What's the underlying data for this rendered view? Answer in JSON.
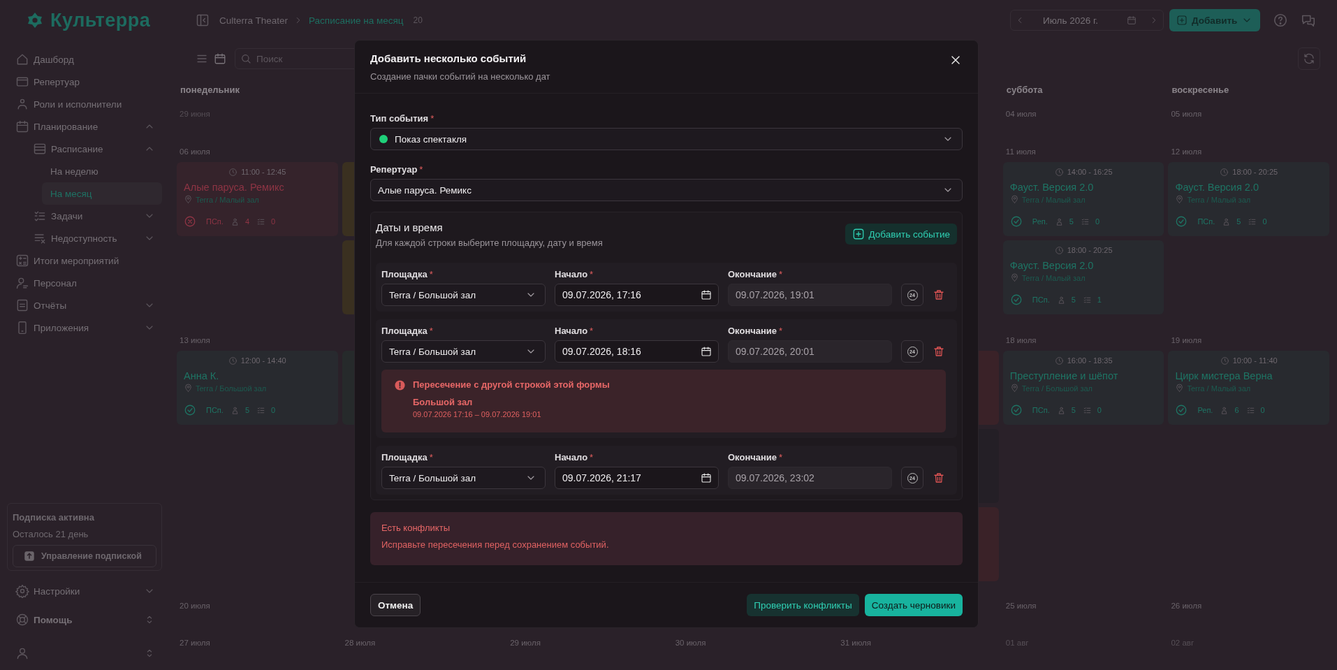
{
  "sidebar": {
    "logo": "Культерра",
    "items": [
      {
        "label": "Дашборд",
        "kind": "link",
        "selected": false
      },
      {
        "label": "Репертуар",
        "kind": "link",
        "selected": false
      },
      {
        "label": "Роли и исполнители",
        "kind": "link",
        "selected": false
      },
      {
        "label": "Планирование",
        "kind": "group",
        "expanded": true,
        "selected": false,
        "children": [
          {
            "label": "Расписание",
            "kind": "group",
            "expanded": true,
            "selected": false,
            "children": [
              {
                "label": "На неделю",
                "kind": "link",
                "selected": false
              },
              {
                "label": "На месяц",
                "kind": "link",
                "selected": true
              }
            ]
          },
          {
            "label": "Задачи",
            "kind": "group",
            "expanded": false,
            "selected": false
          },
          {
            "label": "Недоступность",
            "kind": "group",
            "expanded": false,
            "selected": false
          }
        ]
      },
      {
        "label": "Итоги мероприятий",
        "kind": "link",
        "selected": false
      },
      {
        "label": "Персонал",
        "kind": "link",
        "selected": false
      },
      {
        "label": "Отчёты",
        "kind": "group",
        "expanded": false,
        "selected": false
      },
      {
        "label": "Приложения",
        "kind": "group",
        "expanded": false,
        "selected": false
      }
    ],
    "subscription": {
      "title": "Подписка активна",
      "remaining": "Осталось 21 день",
      "button": "Управление подпиской"
    },
    "footer_items": [
      {
        "label": "Настройки",
        "kind": "group",
        "expanded": false
      },
      {
        "label": "Помощь",
        "kind": "switcher"
      },
      {
        "kind": "user"
      }
    ]
  },
  "topbar": {
    "breadcrumbs": [
      {
        "label": "Culterra Theater",
        "selected": false
      },
      {
        "label": "Расписание на месяц",
        "selected": true
      }
    ],
    "count": "20",
    "month": "Июль 2026 г.",
    "add_button": "Добавить"
  },
  "toolbar": {
    "views": [
      {
        "kind": "list",
        "selected": false
      },
      {
        "kind": "calendar",
        "selected": true
      }
    ],
    "search": {
      "placeholder": "Поиск"
    }
  },
  "calendar": {
    "weekdays": {
      "start": [
        {
          "label": "понедельник"
        }
      ],
      "end": [
        {
          "label": "суббота"
        },
        {
          "label": "воскресенье"
        }
      ]
    },
    "weeks": [
      {
        "start_days": [
          {
            "kind": "day",
            "date": "29 июня",
            "outside": true
          }
        ],
        "end_days": [
          {
            "kind": "day",
            "date": "04 июля",
            "outside": false
          },
          {
            "kind": "day",
            "date": "05 июля",
            "outside": false
          }
        ]
      },
      {
        "start_days": [
          {
            "kind": "day",
            "date": "06 июля",
            "outside": false,
            "events": [
              {
                "time": "11:00 - 12:45",
                "title": "Алые паруса. Ремикс",
                "venue": "Terra / Малый зал",
                "confirmed": false,
                "type": "ПСп.",
                "people": "4",
                "tasks": "0",
                "color": "#8e3444"
              }
            ]
          },
          {
            "kind": "covered",
            "events": [
              {
                "color": "#3a3020"
              },
              {
                "color": "#3a3020"
              }
            ]
          }
        ],
        "end_days": [
          {
            "kind": "day",
            "date": "11 июля",
            "outside": false,
            "events": [
              {
                "time": "14:00 - 16:25",
                "title": "Фауст. Версия 2.0",
                "venue": "Terra / Малый зал",
                "confirmed": true,
                "type": "Реп.",
                "people": "5",
                "tasks": "0",
                "color": "#1e7464"
              },
              {
                "time": "18:00 - 20:25",
                "title": "Фауст. Версия 2.0",
                "venue": "Terra / Малый зал",
                "confirmed": true,
                "type": "ПСп.",
                "people": "5",
                "tasks": "1",
                "color": "#1e7464"
              }
            ]
          },
          {
            "kind": "day",
            "date": "12 июля",
            "outside": false,
            "events": [
              {
                "time": "18:00 - 20:25",
                "title": "Фауст. Версия 2.0",
                "venue": "Terra / Малый зал",
                "confirmed": true,
                "type": "ПСп.",
                "people": "5",
                "tasks": "0",
                "color": "#1e7464"
              }
            ]
          }
        ]
      },
      {
        "start_days": [
          {
            "kind": "day",
            "date": "13 июля",
            "outside": false,
            "events": [
              {
                "time": "12:00 - 14:40",
                "title": "Анна К.",
                "venue": "Terra / Большой зал",
                "confirmed": true,
                "type": "ПСп.",
                "people": "5",
                "tasks": "0",
                "color": "#1e7464"
              }
            ]
          },
          {
            "kind": "covered",
            "events": [
              {
                "color": "#262a2b"
              }
            ]
          }
        ],
        "end_days": [
          {
            "kind": "covered",
            "events": [
              {
                "color": "#3a2228"
              },
              {
                "color": "#241f26"
              },
              {
                "color": "#3a2228"
              }
            ]
          },
          {
            "kind": "day",
            "date": "18 июля",
            "outside": false,
            "events": [
              {
                "time": "16:00 - 18:35",
                "title": "Преступление и шёпот",
                "venue": "Terra / Большой зал",
                "confirmed": true,
                "type": "ПСп.",
                "people": "5",
                "tasks": "0",
                "color": "#1e7464"
              }
            ]
          },
          {
            "kind": "day",
            "date": "19 июля",
            "outside": false,
            "events": [
              {
                "time": "10:00 - 11:40",
                "title": "Цирк мистера Верна",
                "venue": "Terra / Малый зал",
                "confirmed": true,
                "type": "Реп.",
                "people": "6",
                "tasks": "0",
                "color": "#1e7464"
              }
            ]
          }
        ]
      },
      {
        "start_days": [
          {
            "kind": "day",
            "date": "20 июля",
            "outside": false
          }
        ],
        "end_days": [
          {
            "kind": "day",
            "date": "25 июля",
            "outside": false
          },
          {
            "kind": "day",
            "date": "26 июля",
            "outside": false
          }
        ]
      },
      {
        "start_days": [
          {
            "kind": "day",
            "date": "27 июля",
            "outside": false
          },
          {
            "kind": "day",
            "date": "28 июля",
            "outside": false
          },
          {
            "kind": "day",
            "date": "29 июля",
            "outside": false
          },
          {
            "kind": "day",
            "date": "30 июля",
            "outside": false
          },
          {
            "kind": "day",
            "date": "31 июля",
            "outside": false
          },
          {
            "kind": "day",
            "date": "01 авг",
            "outside": true
          },
          {
            "kind": "day",
            "date": "02 авг",
            "outside": true
          }
        ]
      }
    ]
  },
  "dialog": {
    "title": "Добавить несколько событий",
    "subtitle": "Создание пачки событий на несколько дат",
    "event_type": {
      "label": "Тип события",
      "required_mark": "*",
      "value": "Показ спектакля",
      "color": "#1fd07a"
    },
    "repertoire": {
      "label": "Репертуар",
      "required_mark": "*",
      "value": "Алые паруса. Ремикс"
    },
    "schedule": {
      "title": "Даты и время",
      "hint": "Для каждой строки выберите площадку, дату и время",
      "add_button": "Добавить событие",
      "rows": [
        {
          "venue": {
            "label": "Площадка",
            "required_mark": "*",
            "value": "Terra / Большой зал"
          },
          "start": {
            "label": "Начало",
            "required_mark": "*",
            "value": "09.07.2026, 17:16"
          },
          "end": {
            "label": "Окончание",
            "required_mark": "*",
            "value": "09.07.2026, 19:01"
          },
          "auto_button": "24"
        },
        {
          "venue": {
            "label": "Площадка",
            "required_mark": "*",
            "value": "Terra / Большой зал"
          },
          "start": {
            "label": "Начало",
            "required_mark": "*",
            "value": "09.07.2026, 18:16"
          },
          "end": {
            "label": "Окончание",
            "required_mark": "*",
            "value": "09.07.2026, 20:01"
          },
          "auto_button": "24",
          "conflict": {
            "title": "Пересечение с другой строкой этой формы",
            "venue": "Большой зал",
            "range": "09.07.2026 17:16 – 09.07.2026 19:01"
          }
        },
        {
          "venue": {
            "label": "Площадка",
            "required_mark": "*",
            "value": "Terra / Большой зал"
          },
          "start": {
            "label": "Начало",
            "required_mark": "*",
            "value": "09.07.2026, 21:17"
          },
          "end": {
            "label": "Окончание",
            "required_mark": "*",
            "value": "09.07.2026, 23:02"
          },
          "auto_button": "24"
        }
      ]
    },
    "alert": {
      "title": "Есть конфликты",
      "message": "Исправьте пересечения перед сохранением событий."
    },
    "buttons": [
      {
        "label": "Отмена",
        "kind": "secondary"
      },
      {
        "label": "Проверить конфликты",
        "kind": "tonal"
      },
      {
        "label": "Создать черновики",
        "kind": "primary"
      }
    ]
  }
}
